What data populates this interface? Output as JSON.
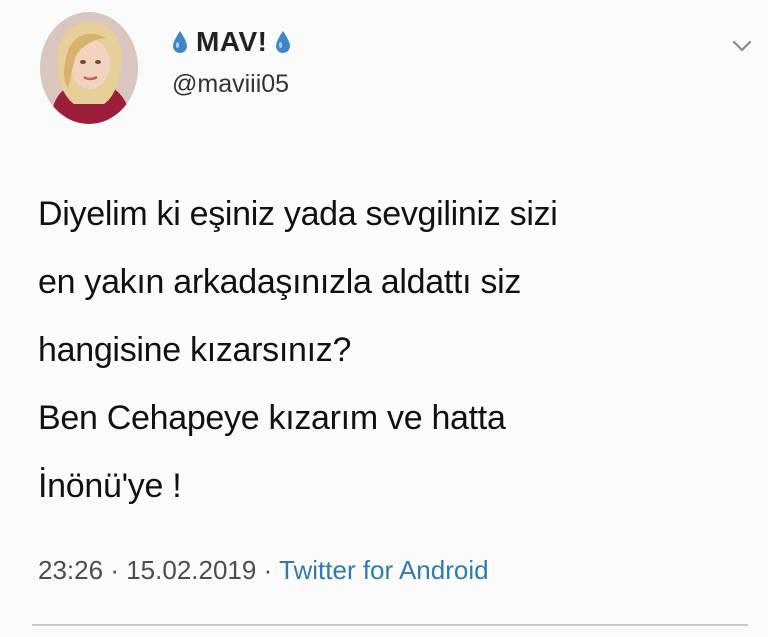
{
  "author": {
    "display_name": "MAV!",
    "handle": "@maviii05",
    "name_emoji_left": "drop-icon",
    "name_emoji_right": "drop-icon",
    "accent_color": "#3d87c9"
  },
  "menu": {
    "icon": "chevron-down-icon"
  },
  "tweet": {
    "lines": [
      "Diyelim ki eşiniz yada sevgiliniz sizi",
      "en yakın arkadaşınızla aldattı siz",
      "hangisine kızarsınız?",
      "Ben Cehapeye kızarım ve hatta",
      "İnönü'ye !"
    ]
  },
  "meta": {
    "time": "23:26",
    "date": "15.02.2019",
    "separator": "·",
    "source": "Twitter for Android",
    "source_color": "#2f7bb0"
  }
}
